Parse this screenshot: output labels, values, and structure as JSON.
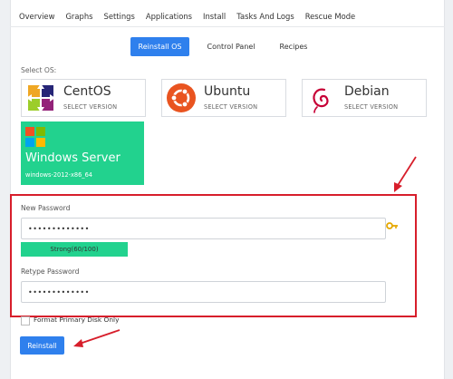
{
  "tabs": [
    {
      "label": "Overview"
    },
    {
      "label": "Graphs"
    },
    {
      "label": "Settings"
    },
    {
      "label": "Applications"
    },
    {
      "label": "Install",
      "active": true
    },
    {
      "label": "Tasks And Logs"
    },
    {
      "label": "Rescue Mode"
    }
  ],
  "subtabs": {
    "reinstall_os": "Reinstall OS",
    "control_panel": "Control Panel",
    "recipes": "Recipes"
  },
  "select_os_label": "Select OS:",
  "os": [
    {
      "name": "CentOS",
      "sub": "SELECT VERSION",
      "icon": "centos-logo-icon"
    },
    {
      "name": "Ubuntu",
      "sub": "SELECT VERSION",
      "icon": "ubuntu-logo-icon"
    },
    {
      "name": "Debian",
      "sub": "SELECT VERSION",
      "icon": "debian-logo-icon"
    }
  ],
  "selected_os": {
    "name": "Windows Server",
    "version": "windows-2012-x86_64",
    "icon": "windows-logo-icon"
  },
  "password": {
    "new_label": "New Password",
    "new_value": "•••••••••••••",
    "strength": "Strong(60/100)",
    "retype_label": "Retype Password",
    "retype_value": "•••••••••••••"
  },
  "format_primary_disk_label": "Format Primary Disk Only",
  "reinstall_button": "Reinstall",
  "colors": {
    "accent_blue": "#2f80ed",
    "selected_green": "#22d28e",
    "annotation_red": "#d71e2b"
  }
}
